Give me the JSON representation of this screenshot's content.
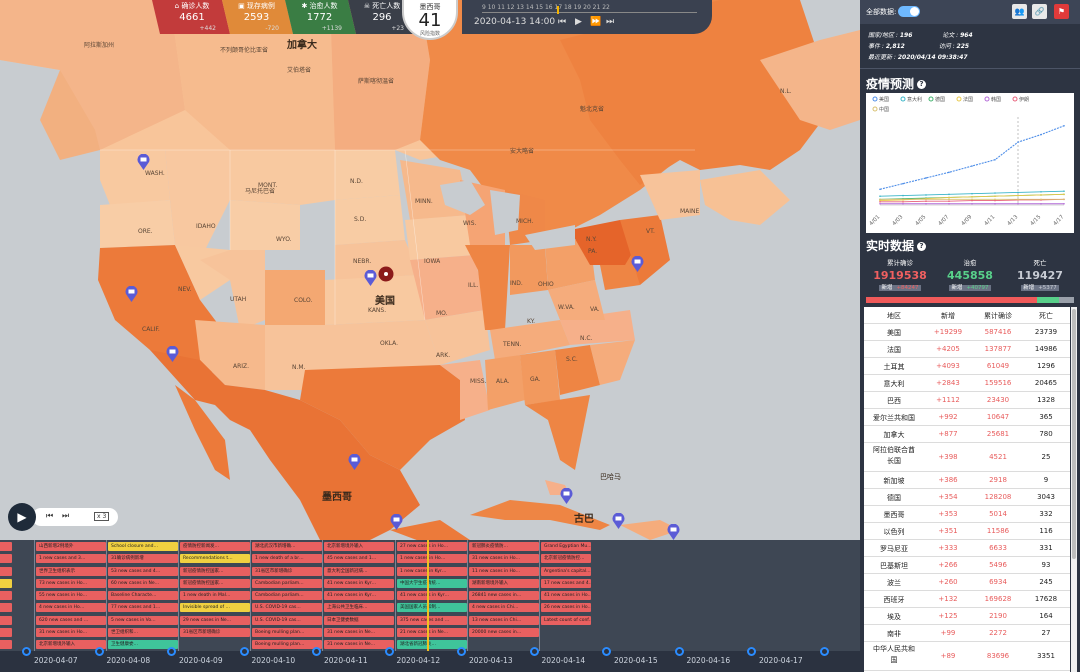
{
  "stats": {
    "confirmed": {
      "label": "确诊人数",
      "value": "4661",
      "delta": "+442",
      "color": "#c23b3b"
    },
    "existing": {
      "label": "现存病例",
      "value": "2593",
      "delta": "-720",
      "color": "#e08a39"
    },
    "cured": {
      "label": "治愈人数",
      "value": "1772",
      "delta": "+1139",
      "color": "#3a7d44"
    },
    "dead": {
      "label": "死亡人数",
      "value": "296",
      "delta": "+23",
      "color": "#3a3f49"
    }
  },
  "country_badge": {
    "name": "墨西哥",
    "value": "41",
    "sub": "风险指数"
  },
  "timeline": {
    "hours": "9    10    11    12    13    14    15    16    17    18    19    20    21    22",
    "current": "2020-04-13 14:00"
  },
  "player": {
    "speed": "x 3"
  },
  "map_labels": {
    "canada": "加拿大",
    "usa": "美国",
    "mexico": "墨西哥",
    "cuba": "古巴",
    "bahamas": "巴哈马",
    "alaska": "阿拉斯加州",
    "bc": "不列颠哥伦比亚省",
    "alberta": "艾伯塔省",
    "sask": "萨斯喀彻温省",
    "manitoba": "马尼托巴省",
    "ontario": "安大略省",
    "quebec": "魁北克省",
    "nl": "N.L.",
    "wash": "WASH.",
    "ore": "ORE.",
    "calif": "CALIF.",
    "nev": "NEV.",
    "idaho": "IDAHO",
    "mont": "MONT.",
    "wyo": "WYO.",
    "utah": "UTAH",
    "colo": "COLO.",
    "ariz": "ARIZ.",
    "nm": "N.M.",
    "nd": "N.D.",
    "sd": "S.D.",
    "nebr": "NEBR.",
    "kans": "KANS.",
    "okla": "OKLA.",
    "minn": "MINN.",
    "iowa": "IOWA",
    "mo": "MO.",
    "ark": "ARK.",
    "wis": "WIS.",
    "ill": "ILL.",
    "mich": "MICH.",
    "ind": "IND.",
    "ohio": "OHIO",
    "ky": "KY.",
    "tenn": "TENN.",
    "miss": "MISS.",
    "ala": "ALA.",
    "ga": "GA.",
    "sc": "S.C.",
    "nc": "N.C.",
    "va": "VA.",
    "wva": "W.VA.",
    "pa": "PA.",
    "ny": "N.Y.",
    "maine": "MAINE",
    "vt": "VT."
  },
  "events": {
    "dates": [
      "2020-04-07",
      "2020-04-08",
      "2020-04-09",
      "2020-04-10",
      "2020-04-11",
      "2020-04-12",
      "2020-04-13",
      "2020-04-14",
      "2020-04-15",
      "2020-04-16",
      "2020-04-17"
    ],
    "columns": [
      [
        {
          "t": "",
          "c": "#e86060"
        },
        {
          "t": "",
          "c": "#e86060"
        },
        {
          "t": "",
          "c": "#e86060"
        },
        {
          "t": "",
          "c": "#f0d040"
        },
        {
          "t": "",
          "c": "#e86060"
        },
        {
          "t": "",
          "c": "#e86060"
        },
        {
          "t": "",
          "c": "#e86060"
        },
        {
          "t": "",
          "c": "#e86060"
        },
        {
          "t": "",
          "c": "#e86060"
        }
      ],
      [
        {
          "t": "山西新增2例境外",
          "c": "#e86060"
        },
        {
          "t": "1 new cases and 3…",
          "c": "#e86060"
        },
        {
          "t": "世界卫生组织表示",
          "c": "#e86060"
        },
        {
          "t": "73 new cases in Ho…",
          "c": "#e86060"
        },
        {
          "t": "55 new cases in Ho…",
          "c": "#e86060"
        },
        {
          "t": "4 new cases in Ho…",
          "c": "#e86060"
        },
        {
          "t": "620 new cases and …",
          "c": "#e86060"
        },
        {
          "t": "31 new cases in Ho…",
          "c": "#e86060"
        },
        {
          "t": "北京新增境外输入",
          "c": "#e86060"
        }
      ],
      [
        {
          "t": "School closure and…",
          "c": "#f0d040"
        },
        {
          "t": "31确诊病例新增",
          "c": "#e86060"
        },
        {
          "t": "53 new cases and 4…",
          "c": "#e86060"
        },
        {
          "t": "60 new cases in Ne…",
          "c": "#e86060"
        },
        {
          "t": "Baseline Characte…",
          "c": "#e86060"
        },
        {
          "t": "77 new cases and 1…",
          "c": "#e86060"
        },
        {
          "t": "5 new cases in Vo…",
          "c": "#e86060"
        },
        {
          "t": "世卫组织和…",
          "c": "#e86060"
        },
        {
          "t": "卫生健康委…",
          "c": "#3fc49a"
        }
      ],
      [
        {
          "t": "疫情防控新闻发…",
          "c": "#e86060"
        },
        {
          "t": "Recommendations t…",
          "c": "#f0d040"
        },
        {
          "t": "新冠疫情防控国家…",
          "c": "#e86060"
        },
        {
          "t": "新冠疫情防控国家…",
          "c": "#e86060"
        },
        {
          "t": "1 new death in Mal…",
          "c": "#e86060"
        },
        {
          "t": "Invisible spread of …",
          "c": "#f0d040"
        },
        {
          "t": "29 new cases in Ne…",
          "c": "#e86060"
        },
        {
          "t": "31省区市新增确诊",
          "c": "#e86060"
        }
      ],
      [
        {
          "t": "湖北武汉市新增确…",
          "c": "#e86060"
        },
        {
          "t": "1 new death of a br…",
          "c": "#e86060"
        },
        {
          "t": "31省区市新增确诊",
          "c": "#e86060"
        },
        {
          "t": "Cambodian parliam…",
          "c": "#e86060"
        },
        {
          "t": "Cambodian parliam…",
          "c": "#e86060"
        },
        {
          "t": "U.S. COVID-19 cas…",
          "c": "#e86060"
        },
        {
          "t": "U.S. COVID-19 cas…",
          "c": "#e86060"
        },
        {
          "t": "Boeing mulling plan…",
          "c": "#e86060"
        },
        {
          "t": "Boeing mulling plan…",
          "c": "#e86060"
        }
      ],
      [
        {
          "t": "北京新增境外输入",
          "c": "#e86060"
        },
        {
          "t": "45 new cases and 1…",
          "c": "#e86060"
        },
        {
          "t": "意大利全国新冠病…",
          "c": "#e86060"
        },
        {
          "t": "41 new cases in Kyr…",
          "c": "#e86060"
        },
        {
          "t": "41 new cases in Kyr…",
          "c": "#e86060"
        },
        {
          "t": "上海公共卫生临床…",
          "c": "#e86060"
        },
        {
          "t": "日本卫健委数据",
          "c": "#e86060"
        },
        {
          "t": "31 new cases in Ne…",
          "c": "#e86060"
        },
        {
          "t": "31 new cases in Ne…",
          "c": "#e86060"
        }
      ],
      [
        {
          "t": "27 new cases in Ho…",
          "c": "#e86060"
        },
        {
          "t": "1 new cases in Ho…",
          "c": "#e86060"
        },
        {
          "t": "1 new cases in Kyr…",
          "c": "#e86060"
        },
        {
          "t": "中国大学生疫情统…",
          "c": "#3fc49a"
        },
        {
          "t": "41 new cases in Kyr…",
          "c": "#e86060"
        },
        {
          "t": "美国国家人员和制…",
          "c": "#3fc49a"
        },
        {
          "t": "375 new cases and …",
          "c": "#e86060"
        },
        {
          "t": "21 new cases in Ne…",
          "c": "#e86060"
        },
        {
          "t": "湖北省新冠肺炎…",
          "c": "#3fc49a"
        }
      ],
      [
        {
          "t": "新冠肺炎疫情防…",
          "c": "#e86060"
        },
        {
          "t": "31 new cases in Ho…",
          "c": "#e86060"
        },
        {
          "t": "11 new cases in Ho…",
          "c": "#e86060"
        },
        {
          "t": "湖南新增境外输入",
          "c": "#e86060"
        },
        {
          "t": "26841 new cases in…",
          "c": "#e86060"
        },
        {
          "t": "4 new cases in Chi…",
          "c": "#e86060"
        },
        {
          "t": "13 new cases in Chi…",
          "c": "#e86060"
        },
        {
          "t": "20000 new cases in…",
          "c": "#e86060"
        }
      ],
      [
        {
          "t": "Grand Egyptian Mu…",
          "c": "#e86060"
        },
        {
          "t": "北京新冠疫情防控…",
          "c": "#e86060"
        },
        {
          "t": "Argentina's capital…",
          "c": "#e86060"
        },
        {
          "t": "17 new cases and 4…",
          "c": "#e86060"
        },
        {
          "t": "41 new cases in Ho…",
          "c": "#e86060"
        },
        {
          "t": "26 new cases in Ho…",
          "c": "#e86060"
        },
        {
          "t": "Latest count of conf…",
          "c": "#e86060"
        }
      ]
    ]
  },
  "panel": {
    "all_data": "全部数据:",
    "info": {
      "countries_label": "国家/地区 :",
      "countries": "196",
      "papers_label": "论文 :",
      "papers": "964",
      "events_label": "事件 :",
      "events": "2,812",
      "visits_label": "访问 :",
      "visits": "225",
      "updated_label": "最近更新 :",
      "updated": "2020/04/14 09:38:47"
    },
    "forecast_title": "疫情预测",
    "realtime_title": "实时数据",
    "realtime": {
      "confirmed": {
        "label": "累计确诊",
        "value": "1919538",
        "new_label": "新增",
        "new": "+84247"
      },
      "cured": {
        "label": "治愈",
        "value": "445858",
        "new_label": "新增",
        "new": "+40797"
      },
      "dead": {
        "label": "死亡",
        "value": "119427",
        "new_label": "新增",
        "new": "+5377"
      }
    },
    "ratio": {
      "confirmed_frac": 0.82,
      "cured_frac": 0.11,
      "dead_frac": 0.07
    }
  },
  "chart_data": {
    "type": "line",
    "title": "",
    "x": [
      "4/01",
      "4/03",
      "4/05",
      "4/07",
      "4/09",
      "4/11",
      "4/13",
      "4/15",
      "4/17"
    ],
    "legend": [
      "美国",
      "意大利",
      "德国",
      "法国",
      "韩国",
      "伊朗",
      "中国"
    ],
    "legend_colors": [
      "#4e8ee8",
      "#3ab5c8",
      "#42b46e",
      "#e8c94a",
      "#b46ad8",
      "#e8607a",
      "#d8c070"
    ],
    "series": [
      {
        "name": "美国",
        "values": [
          0.25,
          0.34,
          0.43,
          0.52,
          0.62,
          0.72,
          1.0,
          1.12,
          1.26
        ]
      },
      {
        "name": "意大利",
        "values": [
          0.14,
          0.15,
          0.16,
          0.17,
          0.18,
          0.19,
          0.2,
          0.21,
          0.22
        ]
      },
      {
        "name": "德国",
        "values": [
          0.09,
          0.1,
          0.11,
          0.12,
          0.13,
          0.14,
          0.15,
          0.16,
          0.17
        ]
      },
      {
        "name": "法国",
        "values": [
          0.07,
          0.08,
          0.1,
          0.12,
          0.13,
          0.14,
          0.15,
          0.16,
          0.17
        ]
      },
      {
        "name": "韩国",
        "values": [
          0.02,
          0.02,
          0.02,
          0.02,
          0.02,
          0.02,
          0.02,
          0.02,
          0.02
        ]
      },
      {
        "name": "伊朗",
        "values": [
          0.05,
          0.05,
          0.06,
          0.06,
          0.07,
          0.07,
          0.08,
          0.08,
          0.09
        ]
      },
      {
        "name": "中国",
        "values": [
          0.09,
          0.09,
          0.09,
          0.09,
          0.09,
          0.09,
          0.09,
          0.09,
          0.09
        ]
      }
    ],
    "forecast_start": "4/13",
    "ylim": [
      0,
      1.4
    ]
  },
  "table": {
    "headers": [
      "地区",
      "新增",
      "累计确诊",
      "死亡"
    ],
    "rows": [
      [
        "美国",
        "+19299",
        "587416",
        "23739"
      ],
      [
        "法国",
        "+4205",
        "137877",
        "14986"
      ],
      [
        "土耳其",
        "+4093",
        "61049",
        "1296"
      ],
      [
        "意大利",
        "+2843",
        "159516",
        "20465"
      ],
      [
        "巴西",
        "+1112",
        "23430",
        "1328"
      ],
      [
        "爱尔兰共和国",
        "+992",
        "10647",
        "365"
      ],
      [
        "加拿大",
        "+877",
        "25681",
        "780"
      ],
      [
        "阿拉伯联合酋长国",
        "+398",
        "4521",
        "25"
      ],
      [
        "新加坡",
        "+386",
        "2918",
        "9"
      ],
      [
        "德国",
        "+354",
        "128208",
        "3043"
      ],
      [
        "墨西哥",
        "+353",
        "5014",
        "332"
      ],
      [
        "以色列",
        "+351",
        "11586",
        "116"
      ],
      [
        "罗马尼亚",
        "+333",
        "6633",
        "331"
      ],
      [
        "巴基斯坦",
        "+266",
        "5496",
        "93"
      ],
      [
        "波兰",
        "+260",
        "6934",
        "245"
      ],
      [
        "西班牙",
        "+132",
        "169628",
        "17628"
      ],
      [
        "埃及",
        "+125",
        "2190",
        "164"
      ],
      [
        "南非",
        "+99",
        "2272",
        "27"
      ],
      [
        "中华人民共和国",
        "+89",
        "83696",
        "3351"
      ]
    ]
  }
}
